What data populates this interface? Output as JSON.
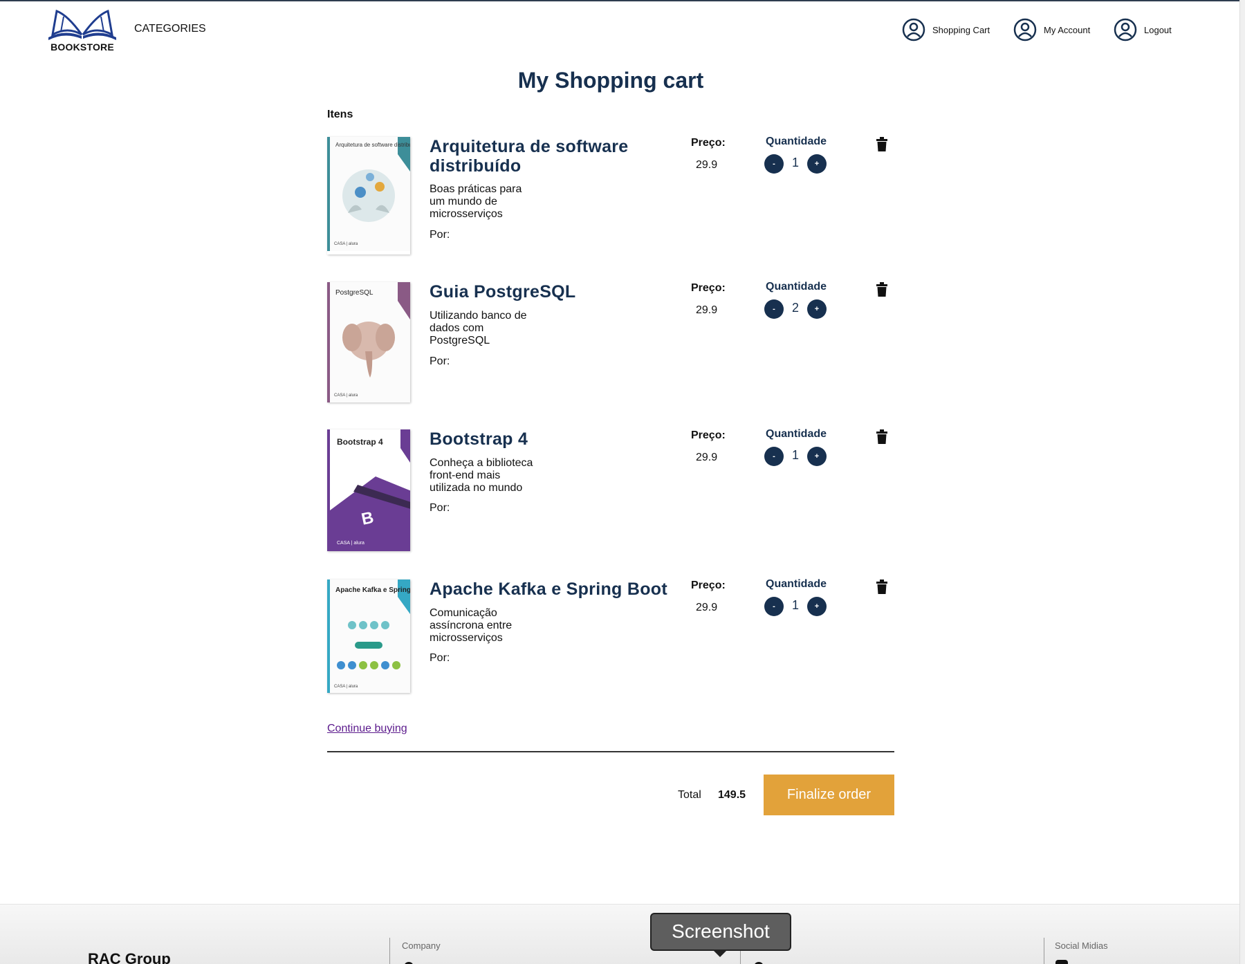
{
  "header": {
    "logo_text": "BOOKSTORE",
    "categories": "CATEGORIES",
    "nav": [
      {
        "label": "Shopping Cart",
        "icon": "user-circle-icon"
      },
      {
        "label": "My Account",
        "icon": "user-circle-icon"
      },
      {
        "label": "Logout",
        "icon": "user-circle-icon"
      }
    ]
  },
  "page_title": "My Shopping cart",
  "items_label": "Itens",
  "price_label": "Preço:",
  "qty_label": "Quantidade",
  "minus_label": "-",
  "plus_label": "+",
  "por_label": "Por:",
  "items": [
    {
      "title": "Arquitetura de software distribuído",
      "subtitle": "Boas práticas para um mundo de microsserviços",
      "price": "29.9",
      "qty": "1",
      "cover_title": "Arquitetura de software distribuído"
    },
    {
      "title": "Guia PostgreSQL",
      "subtitle": "Utilizando banco de dados com PostgreSQL",
      "price": "29.9",
      "qty": "2",
      "cover_title": "PostgreSQL"
    },
    {
      "title": "Bootstrap 4",
      "subtitle": "Conheça a biblioteca front-end mais utilizada no mundo",
      "price": "29.9",
      "qty": "1",
      "cover_title": "Bootstrap 4"
    },
    {
      "title": "Apache Kafka e Spring Boot",
      "subtitle": "Comunicação assíncrona entre microsserviços",
      "price": "29.9",
      "qty": "1",
      "cover_title": "Apache Kafka e Spring Boot"
    }
  ],
  "continue_link": "Continue buying",
  "total_label": "Total",
  "total_value": "149.5",
  "finalize_button": "Finalize order",
  "footer": {
    "brand": "RAC Group",
    "company_title": "Company",
    "social_title": "Social Midias"
  },
  "tooltip": "Screenshot",
  "colors": {
    "primary": "#17304f",
    "accent": "#e2a23a",
    "link": "#5b1a8c"
  }
}
